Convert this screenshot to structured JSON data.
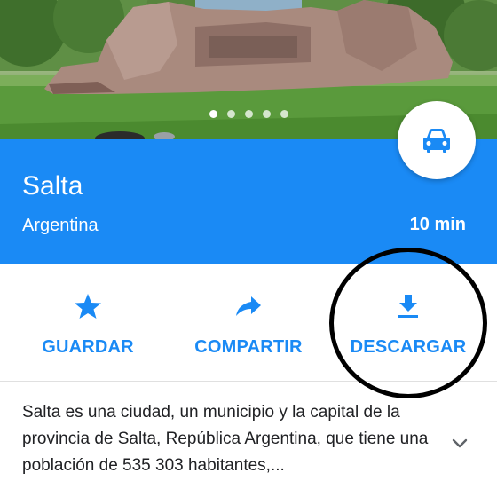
{
  "photo": {
    "carousel": {
      "count": 5,
      "active_index": 0
    }
  },
  "place": {
    "title": "Salta",
    "country": "Argentina",
    "eta": "10 min",
    "directions_icon": "car-icon",
    "accent_color": "#1a8af5"
  },
  "actions": [
    {
      "label": "GUARDAR",
      "icon": "star-icon"
    },
    {
      "label": "COMPARTIR",
      "icon": "share-arrow-icon"
    },
    {
      "label": "DESCARGAR",
      "icon": "download-icon"
    }
  ],
  "description": {
    "text": "Salta es una ciudad, un municipio y la capital de la provincia de Salta, República Argentina, que tiene una población de 535 303 habitantes,...",
    "expand_icon": "chevron-down-icon"
  }
}
